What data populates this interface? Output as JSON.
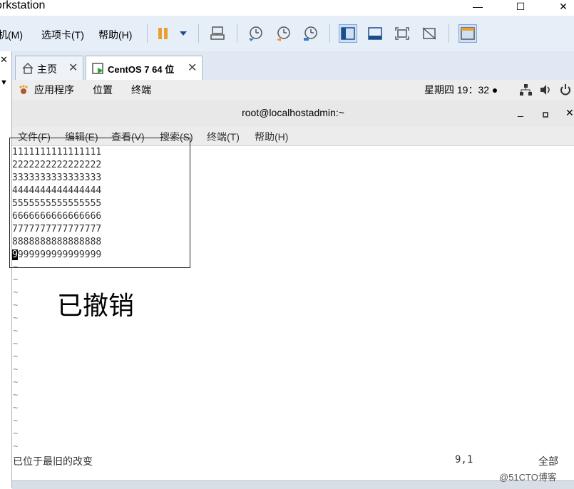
{
  "window": {
    "title": "orkstation",
    "min": "—",
    "max": "☐",
    "close": "✕"
  },
  "vm_menu": {
    "machine": "机(M)",
    "tabs": "选项卡(T)",
    "help": "帮助(H)"
  },
  "tabs": [
    {
      "label": "主页",
      "close": "✕"
    },
    {
      "label": "CentOS 7 64 位",
      "close": "✕"
    }
  ],
  "gnome": {
    "apps": "应用程序",
    "places": "位置",
    "terminal": "终端",
    "clock": "星期四 19：32 ●"
  },
  "terminal": {
    "title": "root@localhostadmin:~",
    "menu": [
      "文件(F)",
      "编辑(E)",
      "查看(V)",
      "搜索(S)",
      "终端(T)",
      "帮助(H)"
    ],
    "lines": [
      "1111111111111111",
      "2222222222222222",
      "3333333333333333",
      "4444444444444444",
      "5555555555555555",
      "6666666666666666",
      "7777777777777777",
      "8888888888888888",
      "9999999999999999"
    ],
    "tilde": "~"
  },
  "annotation": "已撤销",
  "status": {
    "message": "已位于最旧的改变",
    "position": "9,1",
    "scope": "全部"
  },
  "watermark": "@51CTO博客",
  "colors": {
    "accent": "#e8a030",
    "selection": "#cfe0f5"
  }
}
